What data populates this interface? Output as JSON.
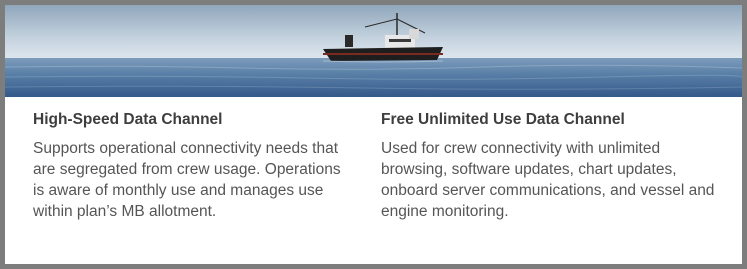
{
  "hero": {
    "image": "fishing-vessel-at-sea",
    "colors": {
      "sky_top": "#9fb3c5",
      "sky_bottom": "#d6e0e8",
      "sea_top": "#6a8db0",
      "sea_bottom": "#3b6492",
      "hull": "#1e1e1e"
    }
  },
  "channels": [
    {
      "title": "High-Speed Data Channel",
      "description": "Supports operational connectivity needs that are segregated from crew usage. Operations is aware of monthly use and manages use within plan’s MB allotment."
    },
    {
      "title": "Free Unlimited Use Data Channel",
      "description": "Used for crew connectivity with unlimited browsing, software updates, chart updates, onboard server communications, and vessel and engine monitoring."
    }
  ],
  "frame": {
    "border_color": "#7d7d7d"
  }
}
